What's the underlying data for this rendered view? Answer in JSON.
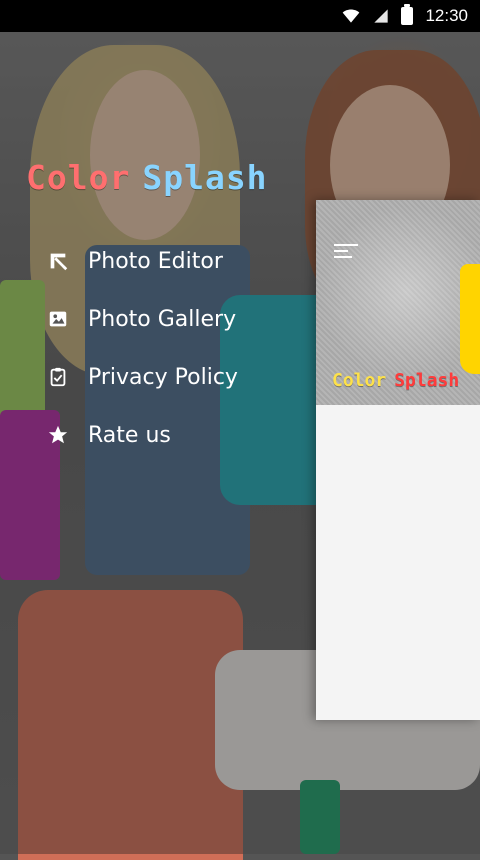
{
  "status": {
    "time": "12:30",
    "icons": [
      "wifi-icon",
      "signal-icon",
      "battery-icon"
    ]
  },
  "drawer": {
    "brand": {
      "part1": "Color",
      "part2": "Splash"
    },
    "items": [
      {
        "label": "Photo Editor",
        "icon": "edit-icon"
      },
      {
        "label": "Photo Gallery",
        "icon": "image-icon"
      },
      {
        "label": "Privacy Policy",
        "icon": "clipboard-check-icon"
      },
      {
        "label": "Rate us",
        "icon": "star-icon"
      }
    ]
  },
  "main": {
    "header_title": {
      "part1": "Color",
      "part2": "Splash"
    }
  },
  "colors": {
    "brand_red": "#ff6f6f",
    "brand_blue": "#89d4ff",
    "panel_yellow": "#fde14a",
    "panel_red": "#ff3b3b",
    "status_bar": "#000000"
  }
}
